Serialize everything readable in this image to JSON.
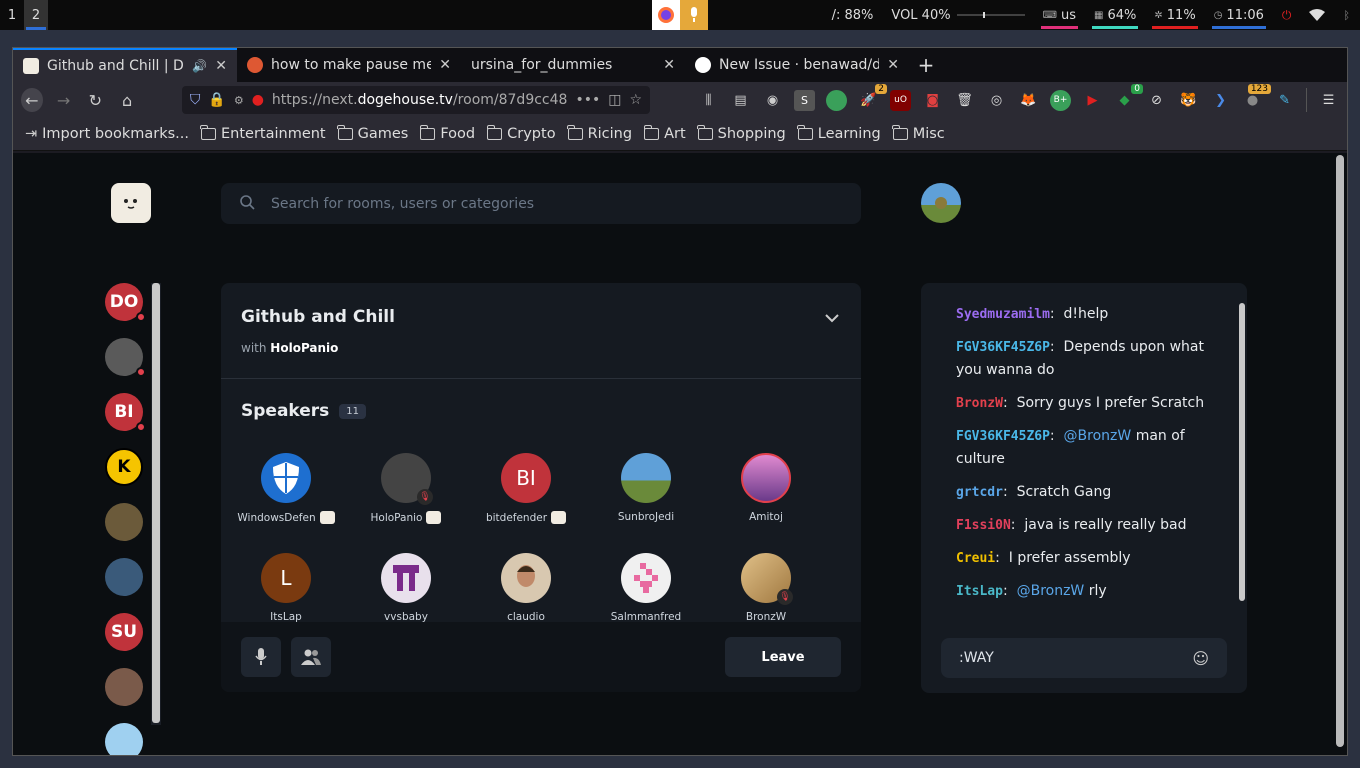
{
  "system_bar": {
    "workspaces": [
      "1",
      "2"
    ],
    "brightness": "/: 88%",
    "volume": "VOL 40%",
    "keyboard": "us",
    "memory": "64%",
    "cpu": "11%",
    "clock": "11:06"
  },
  "tabs": [
    {
      "title": "Github and Chill | Do",
      "active": true
    },
    {
      "title": "how to make pause me",
      "active": false
    },
    {
      "title": "ursina_for_dummies",
      "active": false
    },
    {
      "title": "New Issue · benawad/do",
      "active": false
    }
  ],
  "url": {
    "prefix": "https://next.",
    "domain": "dogehouse.tv",
    "path": "/room/87d9cc48"
  },
  "extensions": {
    "badges": [
      "2",
      "0",
      "123"
    ]
  },
  "bookmarks": {
    "import": "Import bookmarks...",
    "folders": [
      "Entertainment",
      "Games",
      "Food",
      "Crypto",
      "Ricing",
      "Art",
      "Shopping",
      "Learning",
      "Misc"
    ]
  },
  "search": {
    "placeholder": "Search for rooms, users or categories"
  },
  "rail": [
    {
      "initials": "DO",
      "color": "#c0333b",
      "dot": true
    },
    {
      "initials": "",
      "color": "#5a5a5a",
      "dot": true
    },
    {
      "initials": "BI",
      "color": "#c0333b",
      "dot": true
    },
    {
      "initials": "K",
      "color": "#f5c400",
      "dot": false
    },
    {
      "initials": "",
      "color": "#6b5a3a",
      "dot": false
    },
    {
      "initials": "",
      "color": "#3a5a7a",
      "dot": false
    },
    {
      "initials": "SU",
      "color": "#c0333b",
      "dot": false
    },
    {
      "initials": "",
      "color": "#7a5a4a",
      "dot": false
    },
    {
      "initials": "",
      "color": "#9fd0f0",
      "dot": false
    }
  ],
  "room": {
    "title": "Github and Chill",
    "with_label": "with",
    "host": "HoloPanio",
    "speakers_label": "Speakers",
    "speakers_count": "11",
    "speakers": [
      {
        "name": "WindowsDefen",
        "initials": "",
        "color": "#1e6fd0",
        "doge": true,
        "muted": false
      },
      {
        "name": "HoloPanio",
        "initials": "",
        "color": "#444",
        "doge": true,
        "muted": true
      },
      {
        "name": "bitdefender",
        "initials": "BI",
        "color": "#c0333b",
        "doge": true,
        "muted": false
      },
      {
        "name": "SunbroJedi",
        "initials": "",
        "color": "#6a8a3a",
        "doge": false,
        "muted": false
      },
      {
        "name": "Amitoj",
        "initials": "",
        "color": "#b06ab0",
        "doge": false,
        "muted": false
      },
      {
        "name": "ItsLap",
        "initials": "L",
        "color": "#7a3a10",
        "doge": false,
        "muted": false
      },
      {
        "name": "vvsbaby",
        "initials": "",
        "color": "#e8e0ec",
        "doge": false,
        "muted": false
      },
      {
        "name": "claudio",
        "initials": "",
        "color": "#d8c8b0",
        "doge": false,
        "muted": false
      },
      {
        "name": "Salmmanfred",
        "initials": "",
        "color": "#f0f0f0",
        "doge": false,
        "muted": false
      },
      {
        "name": "BronzW",
        "initials": "",
        "color": "#c8a060",
        "doge": false,
        "muted": true
      }
    ],
    "leave_label": "Leave"
  },
  "chat": {
    "messages": [
      {
        "user": "Syedmuzamilm",
        "color": "#9b6cf0",
        "text": "d!help",
        "mention": ""
      },
      {
        "user": "FGV36KF45Z6P",
        "color": "#4ab8e8",
        "text": "Depends upon what you wanna do",
        "mention": ""
      },
      {
        "user": "BronzW",
        "color": "#e2404c",
        "text": "Sorry guys I prefer Scratch",
        "mention": ""
      },
      {
        "user": "FGV36KF45Z6P",
        "color": "#4ab8e8",
        "text": "man of culture",
        "mention": "@BronzW"
      },
      {
        "user": "grtcdr",
        "color": "#5aa6e8",
        "text": "Scratch Gang",
        "mention": ""
      },
      {
        "user": "F1ssi0N",
        "color": "#e2405c",
        "text": "java is really really bad",
        "mention": ""
      },
      {
        "user": "Creui",
        "color": "#f0c000",
        "text": "I prefer assembly",
        "mention": ""
      },
      {
        "user": "ItsLap",
        "color": "#4ab8c8",
        "text": "rly",
        "mention": "@BronzW"
      }
    ],
    "input_value": ":WAY"
  }
}
